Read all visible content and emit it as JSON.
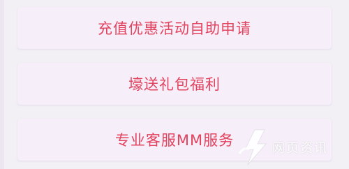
{
  "menu": {
    "items": [
      {
        "label": "充值优惠活动自助申请"
      },
      {
        "label": "壕送礼包福利"
      },
      {
        "label": "专业客服MM服务"
      }
    ]
  },
  "watermark": {
    "text": "网页资讯",
    "icon": "lightning-logo-icon"
  },
  "colors": {
    "accent_text": "#e2435e",
    "button_bg": "#f6effa",
    "page_bg": "#f2eff5"
  }
}
